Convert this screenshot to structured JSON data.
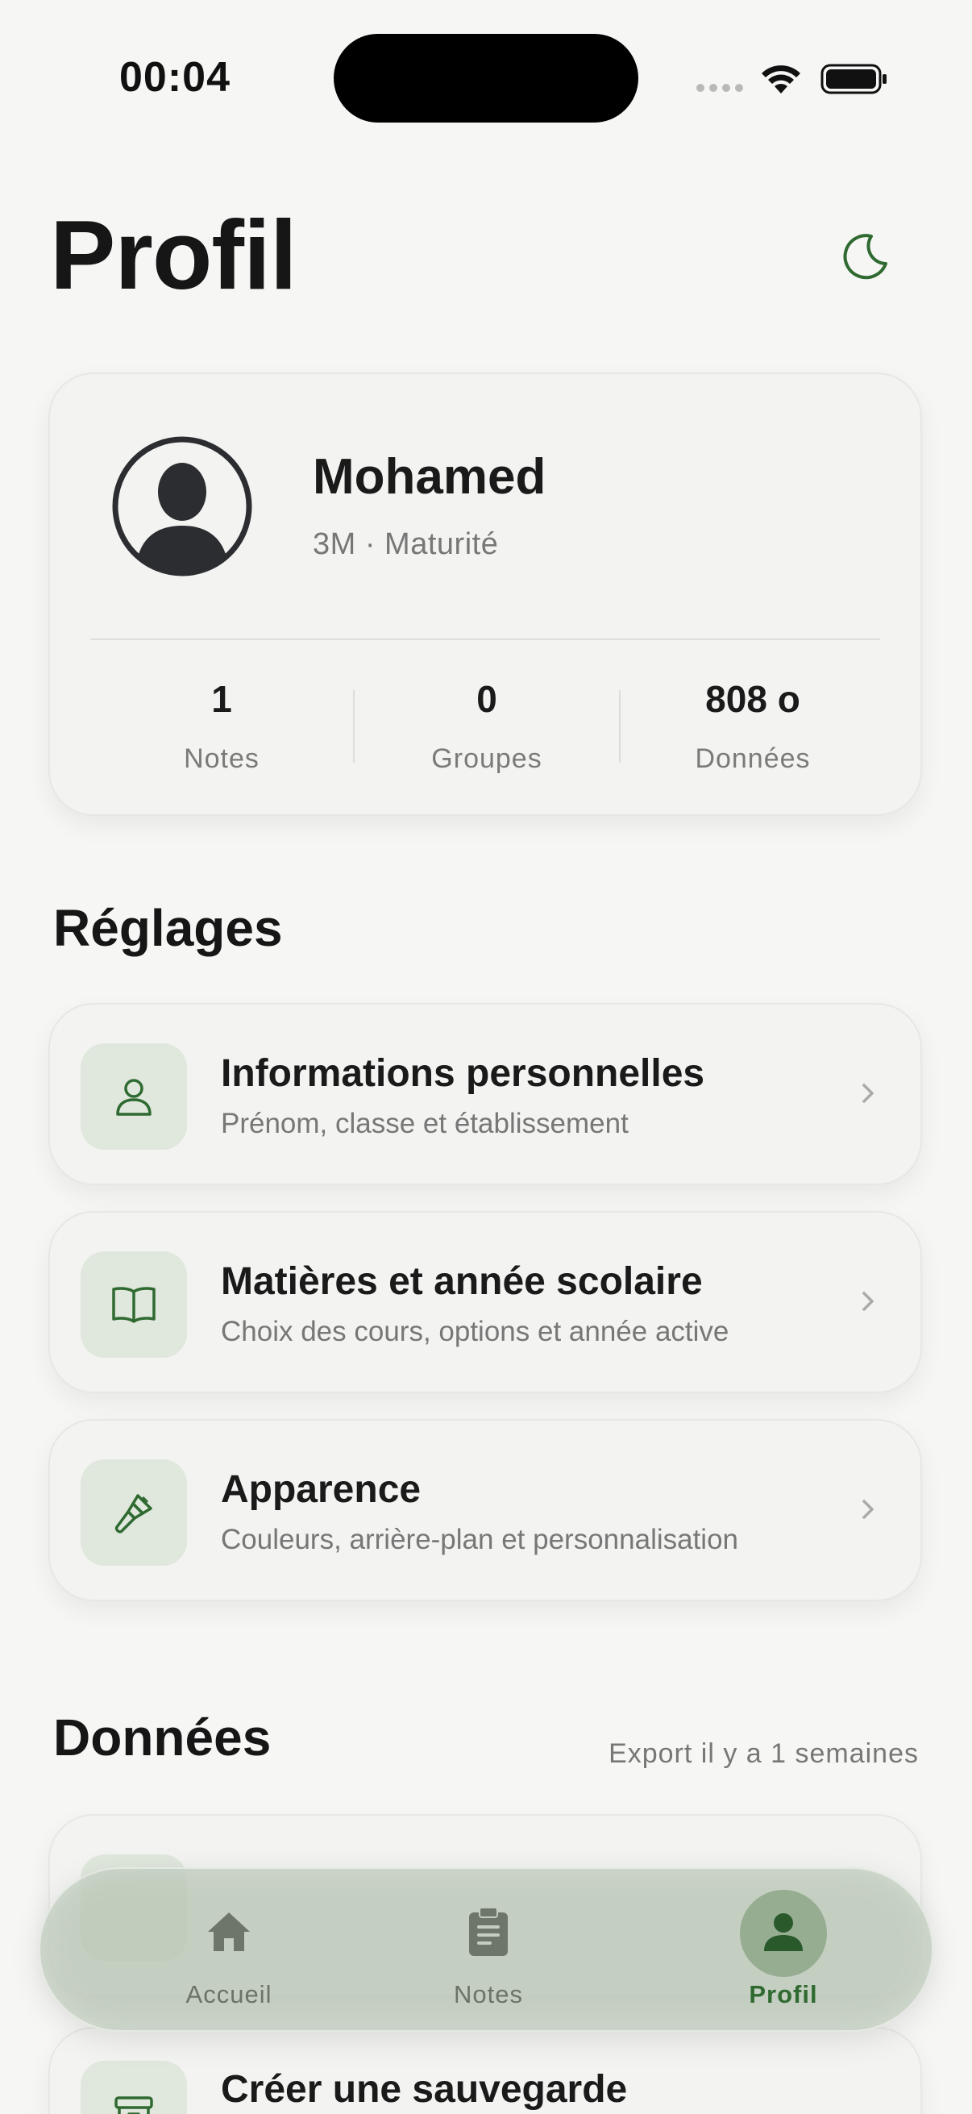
{
  "status_bar": {
    "time": "00:04"
  },
  "header": {
    "title": "Profil",
    "theme_icon": "moon-icon"
  },
  "profile": {
    "name": "Mohamed",
    "subtitle": "3M · Maturité",
    "stats": [
      {
        "value": "1",
        "label": "Notes"
      },
      {
        "value": "0",
        "label": "Groupes"
      },
      {
        "value": "808 o",
        "label": "Données"
      }
    ]
  },
  "settings": {
    "title": "Réglages",
    "items": [
      {
        "title": "Informations personnelles",
        "subtitle": "Prénom, classe et établissement",
        "icon": "person-icon"
      },
      {
        "title": "Matières et année scolaire",
        "subtitle": "Choix des cours, options et année active",
        "icon": "book-icon"
      },
      {
        "title": "Apparence",
        "subtitle": "Couleurs, arrière-plan et personnalisation",
        "icon": "brush-icon"
      }
    ]
  },
  "data_section": {
    "title": "Données",
    "export_note": "Export il y a 1 semaines",
    "items": [
      {
        "title": "Créer une sauvegarde",
        "icon": "archive-icon"
      }
    ]
  },
  "tabbar": {
    "tabs": [
      {
        "label": "Accueil",
        "icon": "home-icon",
        "active": false
      },
      {
        "label": "Notes",
        "icon": "clipboard-icon",
        "active": false
      },
      {
        "label": "Profil",
        "icon": "person-icon",
        "active": true
      }
    ]
  },
  "colors": {
    "accent": "#2f6a31",
    "icon_bg": "#e0e7dd",
    "background": "#f6f6f4"
  }
}
